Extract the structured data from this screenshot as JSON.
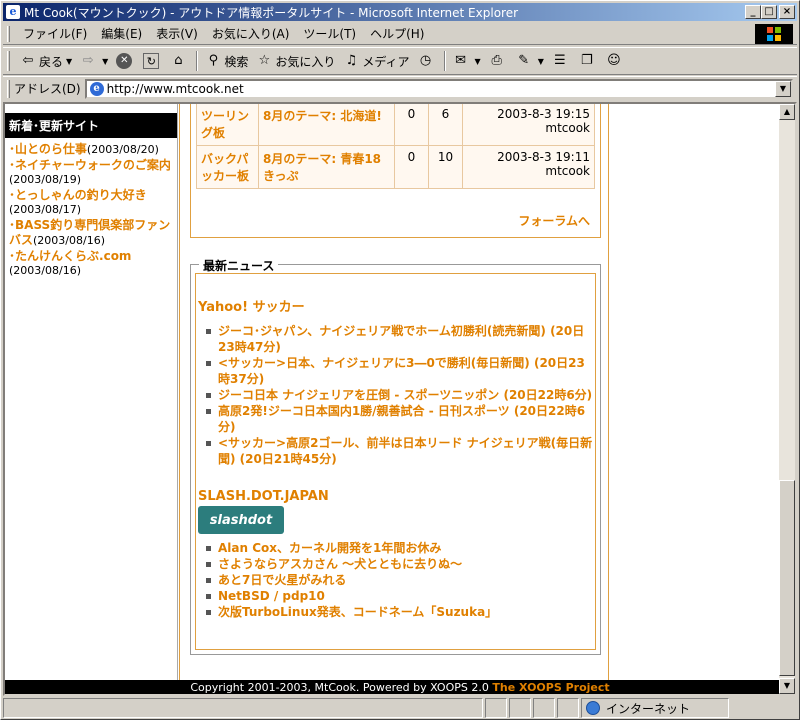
{
  "window": {
    "title": "Mt Cook(マウントクック) - アウトドア情報ポータルサイト - Microsoft Internet Explorer"
  },
  "menu": [
    "ファイル(F)",
    "編集(E)",
    "表示(V)",
    "お気に入り(A)",
    "ツール(T)",
    "ヘルプ(H)"
  ],
  "toolbar": {
    "back": "戻る",
    "search": "検索",
    "favorites": "お気に入り",
    "media": "メディア"
  },
  "address": {
    "label": "アドレス(D)",
    "url": "http://www.mtcook.net"
  },
  "sidebar": {
    "title": "新着･更新サイト",
    "items": [
      {
        "name": "山とのら仕事",
        "date": "(2003/08/20)"
      },
      {
        "name": "ネイチャーウォークのご案内",
        "date": "(2003/08/19)"
      },
      {
        "name": "とっしゃんの釣り大好き",
        "date": "(2003/08/17)"
      },
      {
        "name": "BASS釣り専門倶楽部ファンバス",
        "date": "(2003/08/16)"
      },
      {
        "name": "たんけんくらぶ.com",
        "date": "(2003/08/16)"
      }
    ]
  },
  "forum": {
    "rows": [
      {
        "category": "ツーリング板",
        "topic": "8月のテーマ: 北海道!",
        "replies": "0",
        "views": "6",
        "last_date": "2003-8-3 19:15",
        "last_user": "mtcook"
      },
      {
        "category": "バックパッカー板",
        "topic": "8月のテーマ: 青春18きっぷ",
        "replies": "0",
        "views": "10",
        "last_date": "2003-8-3 19:11",
        "last_user": "mtcook"
      }
    ],
    "more_link": "フォーラムへ"
  },
  "news": {
    "title": "最新ニュース",
    "sources": [
      {
        "name": "Yahoo! サッカー",
        "items": [
          "ジーコ･ジャパン、ナイジェリア戦でホーム初勝利(読売新聞) (20日23時47分)",
          "<サッカー>日本、ナイジェリアに3―0で勝利(毎日新聞) (20日23時37分)",
          "ジーコ日本 ナイジェリアを圧倒 - スポーツニッポン (20日22時6分)",
          "高原2発!ジーコ日本国内1勝/親善試合 - 日刊スポーツ (20日22時6分)",
          "<サッカー>高原2ゴール、前半は日本リード ナイジェリア戦(毎日新聞) (20日21時45分)"
        ]
      },
      {
        "name": "SLASH.DOT.JAPAN",
        "logo": "slashdot",
        "items": [
          "Alan Cox、カーネル開発を1年間お休み",
          "さようならアスカさん ～犬とともに去りぬ～",
          "あと7日で火星がみれる",
          "NetBSD / pdp10",
          "次版TurboLinux発表、コードネーム「Suzuka」"
        ]
      }
    ]
  },
  "footer": {
    "text": "Copyright 2001-2003, MtCook. Powered by XOOPS 2.0",
    "project": "The XOOPS Project"
  },
  "status": {
    "zone": "インターネット"
  },
  "colors": {
    "accent": "#e08000",
    "titlebar": "#0a246a"
  }
}
